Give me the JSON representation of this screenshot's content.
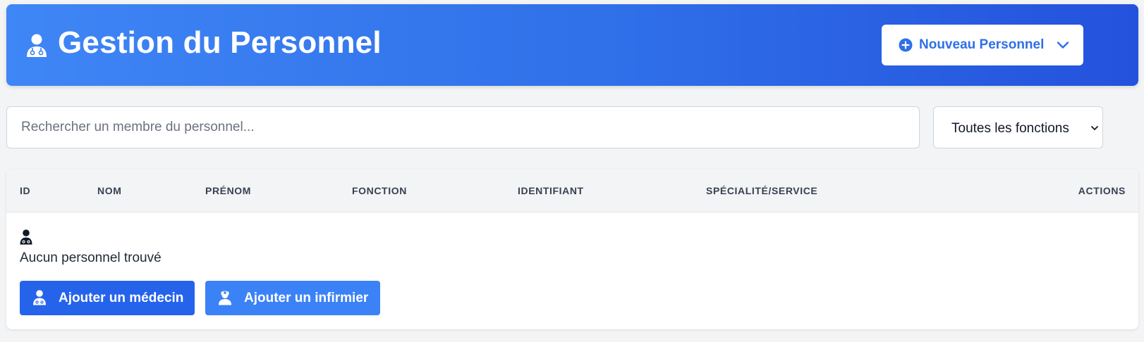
{
  "header": {
    "title": "Gestion du Personnel",
    "icon": "user-doctor-icon",
    "new_button": {
      "label": "Nouveau Personnel",
      "icon": "plus-circle-icon",
      "chevron": "chevron-down-icon"
    },
    "gradient": [
      "#3f86f6",
      "#2452dd"
    ]
  },
  "search": {
    "placeholder": "Rechercher un membre du personnel...",
    "value": ""
  },
  "filter": {
    "selected": "Toutes les fonctions"
  },
  "table": {
    "columns": [
      "ID",
      "NOM",
      "PRÉNOM",
      "FONCTION",
      "IDENTIFIANT",
      "SPÉCIALITÉ/SERVICE",
      "ACTIONS"
    ],
    "rows": []
  },
  "empty_state": {
    "icon": "user-doctor-icon",
    "message": "Aucun personnel trouvé",
    "add_doctor_label": "Ajouter un médecin",
    "add_nurse_label": "Ajouter un infirmier"
  },
  "colors": {
    "primary": "#2563eb",
    "secondary": "#3b82f6"
  }
}
